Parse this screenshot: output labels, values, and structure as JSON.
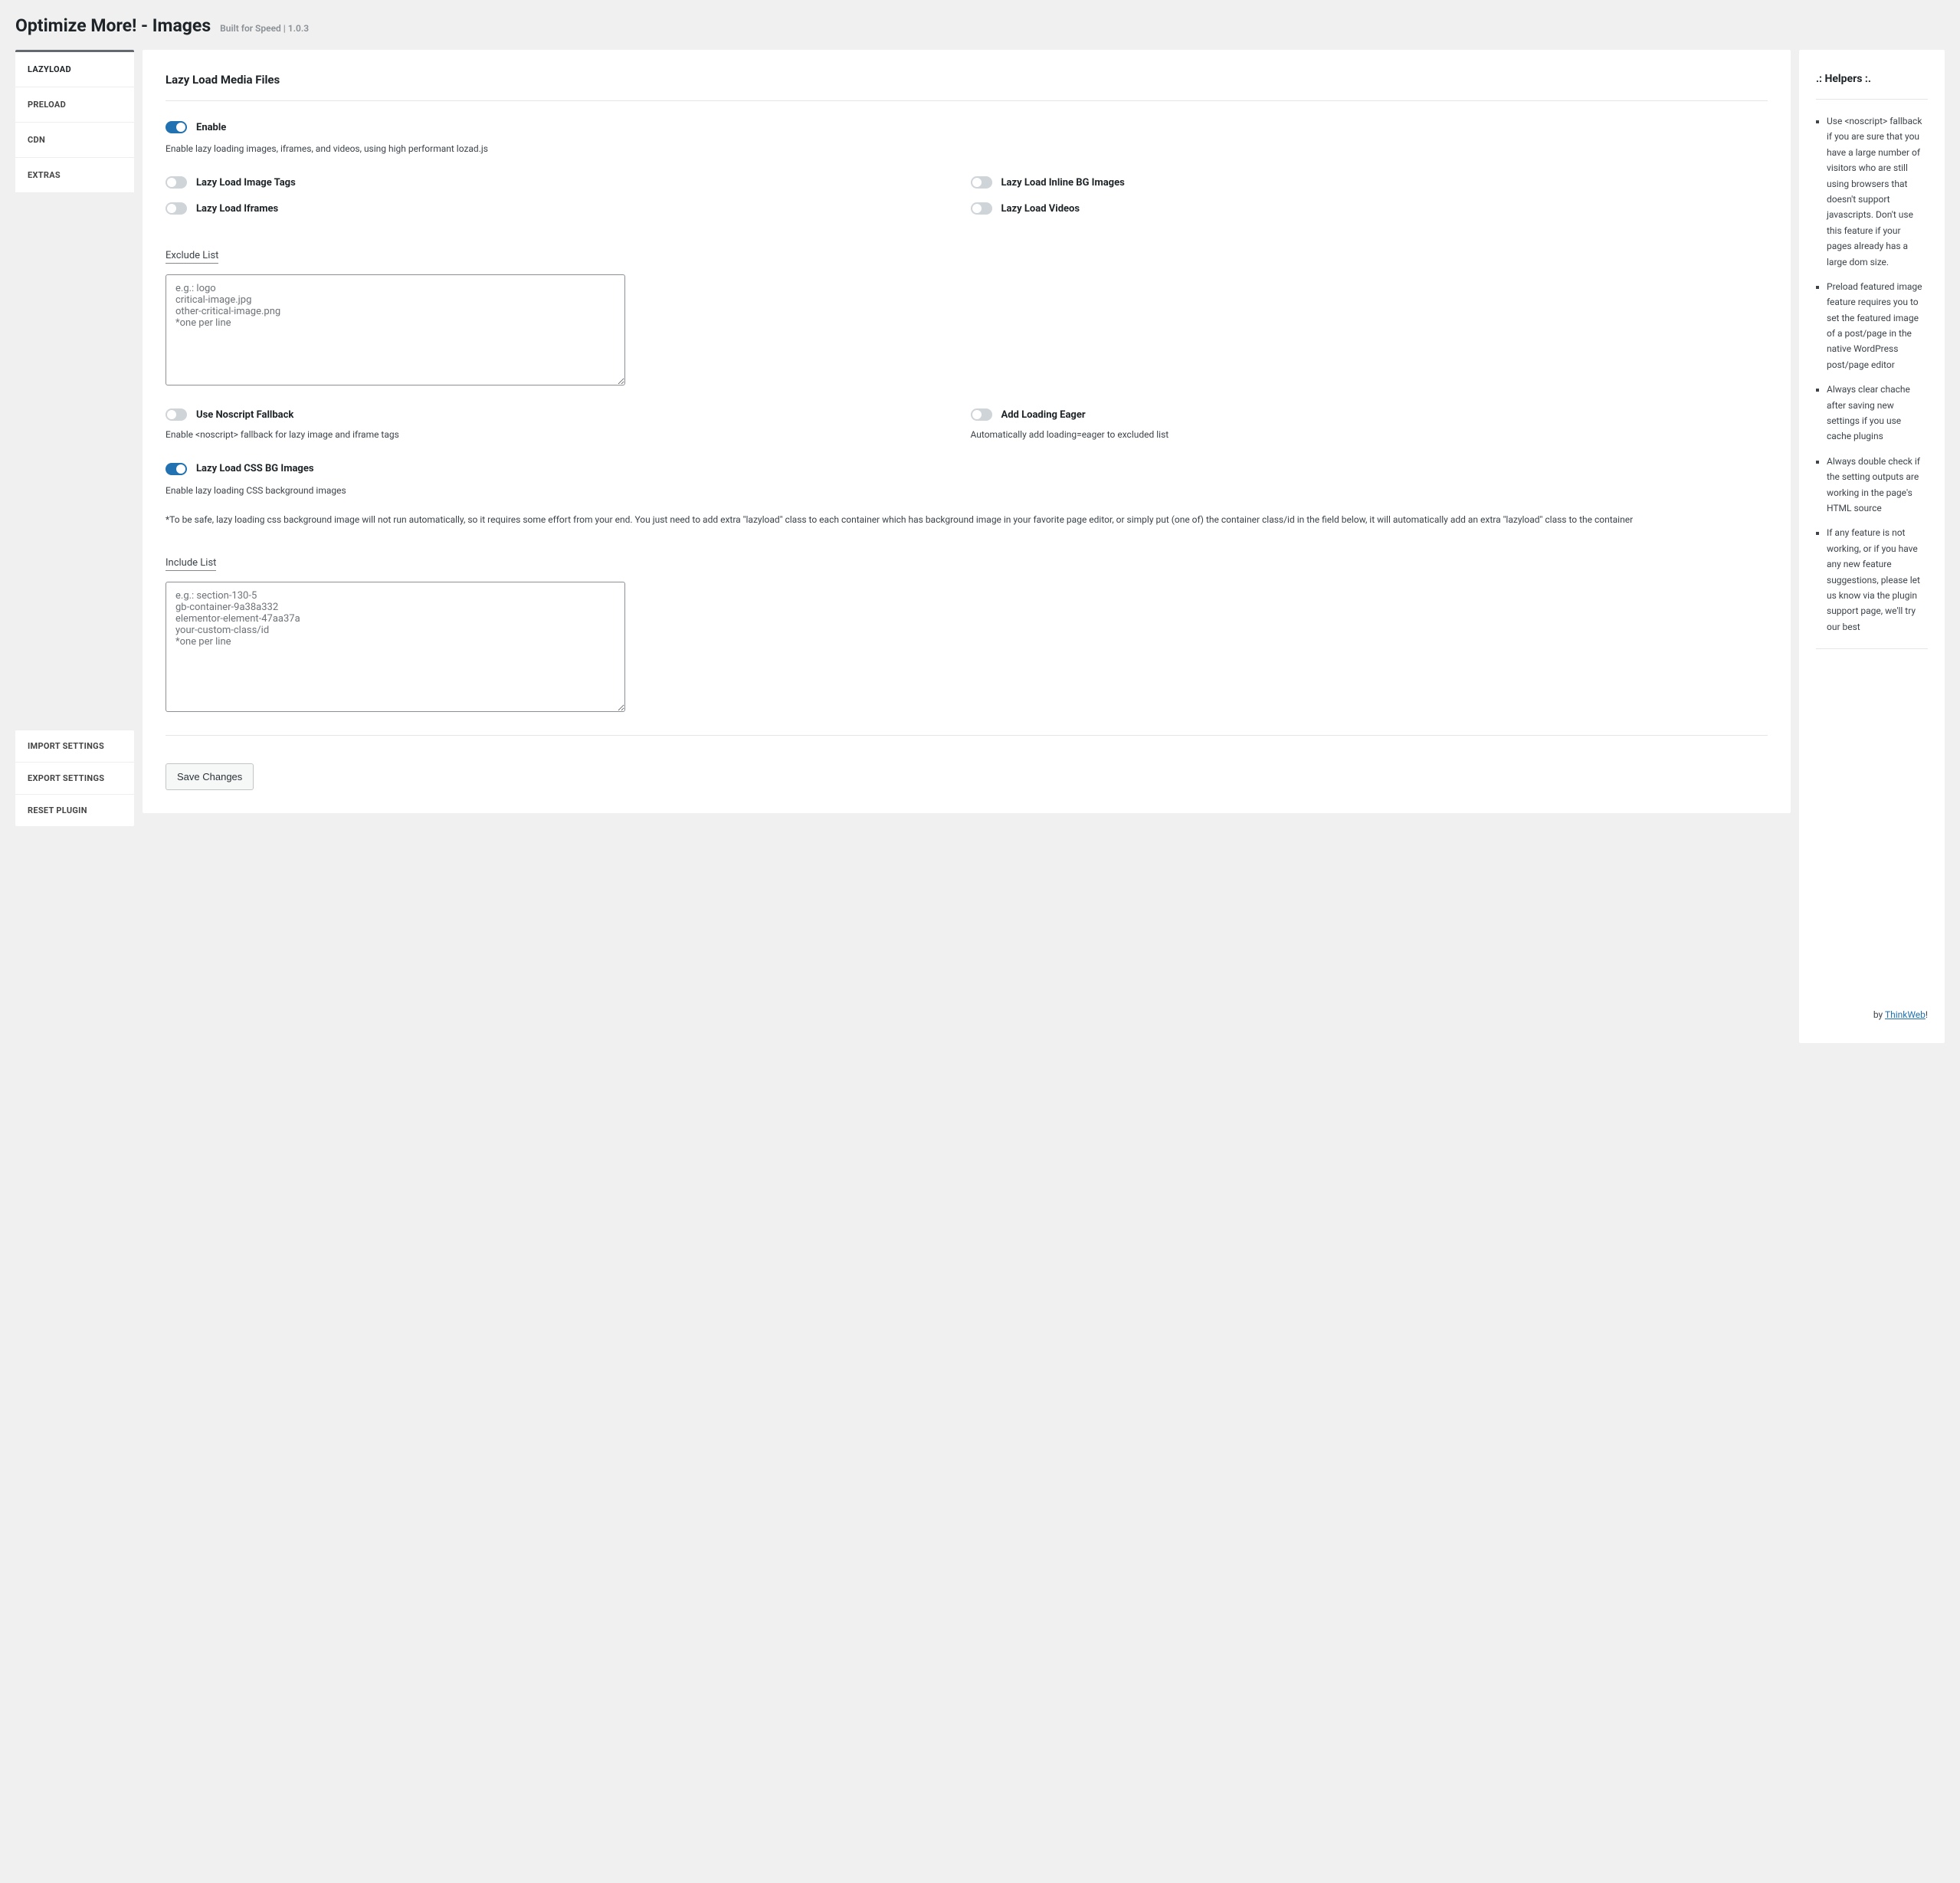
{
  "header": {
    "title": "Optimize More! - Images",
    "tagline": "Built for Speed | 1.0.3"
  },
  "nav": {
    "tabs": [
      "LAZYLOAD",
      "PRELOAD",
      "CDN",
      "EXTRAS"
    ],
    "active": 0,
    "admin": [
      "IMPORT SETTINGS",
      "EXPORT SETTINGS",
      "RESET PLUGIN"
    ]
  },
  "main": {
    "section_title": "Lazy Load Media Files",
    "enable": {
      "label": "Enable",
      "on": true,
      "desc": "Enable lazy loading images, iframes, and videos, using high performant lozad.js"
    },
    "media_toggles": {
      "image_tags": {
        "label": "Lazy Load Image Tags",
        "on": false
      },
      "inline_bg": {
        "label": "Lazy Load Inline BG Images",
        "on": false
      },
      "iframes": {
        "label": "Lazy Load Iframes",
        "on": false
      },
      "videos": {
        "label": "Lazy Load Videos",
        "on": false
      }
    },
    "exclude": {
      "heading": "Exclude List",
      "placeholder": "e.g.: logo\ncritical-image.jpg\nother-critical-image.png\n*one per line",
      "value": ""
    },
    "noscript": {
      "label": "Use Noscript Fallback",
      "on": false,
      "desc": "Enable <noscript> fallback for lazy image and iframe tags"
    },
    "eager": {
      "label": "Add Loading Eager",
      "on": false,
      "desc": "Automatically add loading=eager to excluded list"
    },
    "cssbg": {
      "label": "Lazy Load CSS BG Images",
      "on": true,
      "desc": "Enable lazy loading CSS background images",
      "note": "*To be safe, lazy loading css background image will not run automatically, so it requires some effort from your end. You just need to add extra \"lazyload\" class to each container which has background image in your favorite page editor, or simply put (one of) the container class/id in the field below, it will automatically add an extra \"lazyload\" class to the container"
    },
    "include": {
      "heading": "Include List",
      "placeholder": "e.g.: section-130-5\ngb-container-9a38a332\nelementor-element-47aa37a\nyour-custom-class/id\n*one per line",
      "value": ""
    },
    "save_label": "Save Changes"
  },
  "helpers": {
    "title": ".: Helpers :.",
    "items": [
      "Use <noscript> fallback if you are sure that you have a large number of visitors who are still using browsers that doesn't support javascripts. Don't use this feature if your pages already has a large dom size.",
      "Preload featured image feature requires you to set the featured image of a post/page in the native WordPress post/page editor",
      "Always clear chache after saving new settings if you use cache plugins",
      "Always double check if the setting outputs are working in the page's HTML source",
      "If any feature is not working, or if you have any new feature suggestions, please let us know via the plugin support page, we'll try our best"
    ],
    "footer_prefix": "by ",
    "footer_link": "ThinkWeb",
    "footer_suffix": "!"
  }
}
